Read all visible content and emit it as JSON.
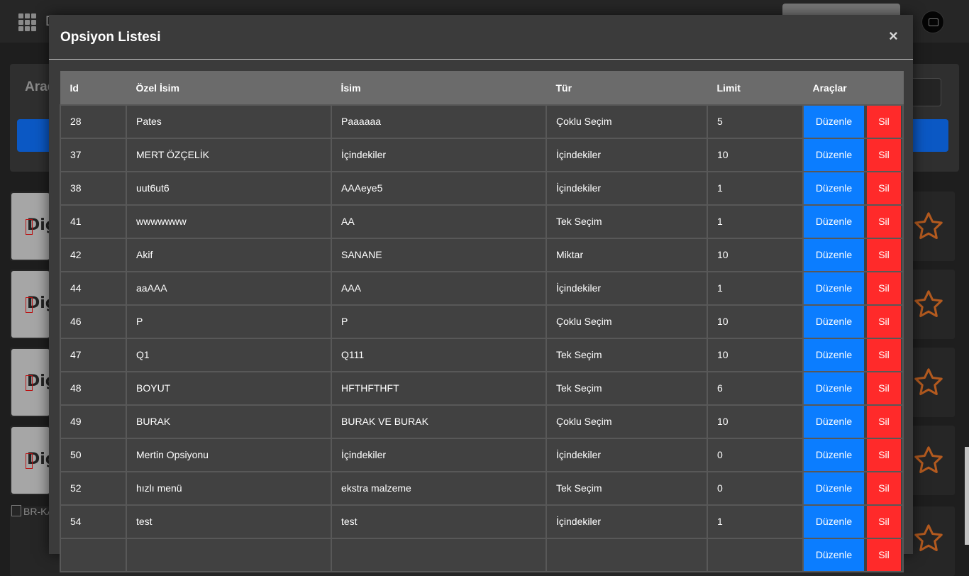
{
  "background": {
    "app_title_fragment": "D",
    "tools_title_fragment": "Araç",
    "broken_image_alt": "BR-KA",
    "logo_fragment": "Dig",
    "colors": {
      "accent_blue": "#0b58c4",
      "star_color": "#b35a1f"
    }
  },
  "modal": {
    "title": "Opsiyon Listesi",
    "close_label": "×",
    "table": {
      "headers": {
        "id": "Id",
        "custom_name": "Özel İsim",
        "name": "İsim",
        "type": "Tür",
        "limit": "Limit",
        "tools": "Araçlar"
      },
      "edit_label": "Düzenle",
      "delete_label": "Sil",
      "rows": [
        {
          "id": "28",
          "custom_name": "Pates",
          "name": "Paaaaaa",
          "type": "Çoklu Seçim",
          "limit": "5"
        },
        {
          "id": "37",
          "custom_name": "MERT ÖZÇELİK",
          "name": "İçindekiler",
          "type": "İçindekiler",
          "limit": "10"
        },
        {
          "id": "38",
          "custom_name": "uut6ut6",
          "name": "AAAeye5",
          "type": "İçindekiler",
          "limit": "1"
        },
        {
          "id": "41",
          "custom_name": "wwwwwww",
          "name": "AA",
          "type": "Tek Seçim",
          "limit": "1"
        },
        {
          "id": "42",
          "custom_name": "Akif",
          "name": "SANANE",
          "type": "Miktar",
          "limit": "10"
        },
        {
          "id": "44",
          "custom_name": "aaAAA",
          "name": "AAA",
          "type": "İçindekiler",
          "limit": "1"
        },
        {
          "id": "46",
          "custom_name": "P",
          "name": "P",
          "type": "Çoklu Seçim",
          "limit": "10"
        },
        {
          "id": "47",
          "custom_name": "Q1",
          "name": "Q111",
          "type": "Tek Seçim",
          "limit": "10"
        },
        {
          "id": "48",
          "custom_name": "BOYUT",
          "name": "HFTHFTHFT",
          "type": "Tek Seçim",
          "limit": "6"
        },
        {
          "id": "49",
          "custom_name": "BURAK",
          "name": "BURAK VE BURAK",
          "type": "Çoklu Seçim",
          "limit": "10"
        },
        {
          "id": "50",
          "custom_name": "Mertin Opsiyonu",
          "name": "İçindekiler",
          "type": "İçindekiler",
          "limit": "0"
        },
        {
          "id": "52",
          "custom_name": "hızlı menü",
          "name": "ekstra malzeme",
          "type": "Tek Seçim",
          "limit": "0"
        },
        {
          "id": "54",
          "custom_name": "test",
          "name": "test",
          "type": "İçindekiler",
          "limit": "1"
        },
        {
          "id": "",
          "custom_name": "",
          "name": "",
          "type": "",
          "limit": ""
        }
      ]
    }
  }
}
